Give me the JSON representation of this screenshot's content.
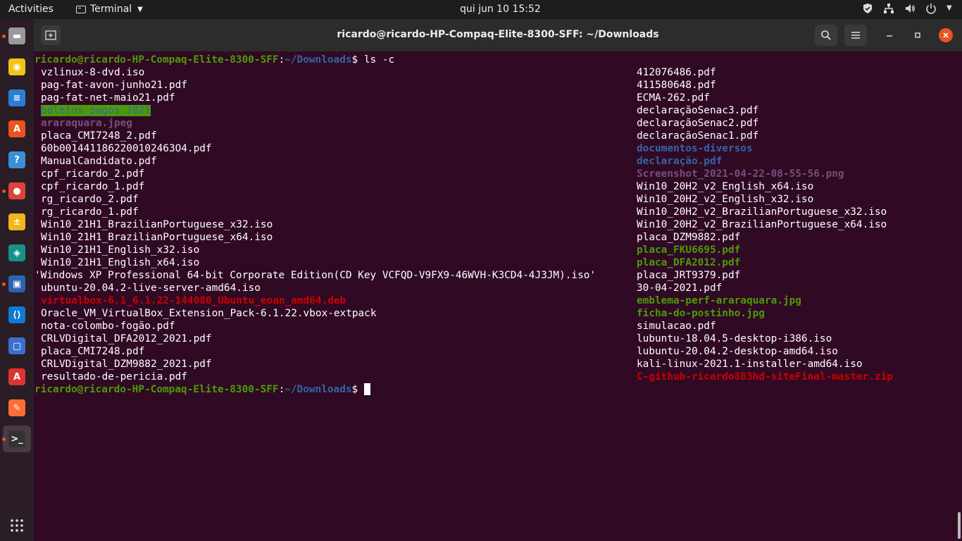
{
  "topbar": {
    "activities": "Activities",
    "app_name": "Terminal",
    "clock": "qui jun 10  15:52"
  },
  "window": {
    "title": "ricardo@ricardo-HP-Compaq-Elite-8300-SFF: ~/Downloads"
  },
  "terminal": {
    "prompt_user": "ricardo@ricardo-HP-Compaq-Elite-8300-SFF",
    "prompt_sep": ":",
    "prompt_path": "~/Downloads",
    "prompt_end": "$ ",
    "command": "ls -c",
    "left_column": [
      {
        "name": "vzlinux-8-dvd.iso",
        "type": "plain"
      },
      {
        "name": "pag-fat-avon-junho21.pdf",
        "type": "plain"
      },
      {
        "name": "pag-fat-net-maio21.pdf",
        "type": "plain"
      },
      {
        "name": "boletos_pagos_2021",
        "type": "otw"
      },
      {
        "name": "araraquara.jpeg",
        "type": "img"
      },
      {
        "name": "placa_CMI7248_2.pdf",
        "type": "plain"
      },
      {
        "name": "60b0014411862200102463O4.pdf",
        "type": "plain"
      },
      {
        "name": "ManualCandidato.pdf",
        "type": "plain"
      },
      {
        "name": "cpf_ricardo_2.pdf",
        "type": "plain"
      },
      {
        "name": "cpf_ricardo_1.pdf",
        "type": "plain"
      },
      {
        "name": "rg_ricardo_2.pdf",
        "type": "plain"
      },
      {
        "name": "rg_ricardo_1.pdf",
        "type": "plain"
      },
      {
        "name": "Win10_21H1_BrazilianPortuguese_x32.iso",
        "type": "plain"
      },
      {
        "name": "Win10_21H1_BrazilianPortuguese_x64.iso",
        "type": "plain"
      },
      {
        "name": "Win10_21H1_English_x32.iso",
        "type": "plain"
      },
      {
        "name": "Win10_21H1_English_x64.iso",
        "type": "plain"
      },
      {
        "name": "'Windows XP Professional 64-bit Corporate Edition(CD Key VCFQD-V9FX9-46WVH-K3CD4-4J3JM).iso'",
        "type": "plain",
        "quoted": true
      },
      {
        "name": "ubuntu-20.04.2-live-server-amd64.iso",
        "type": "plain"
      },
      {
        "name": "virtualbox-6.1_6.1.22-144080_Ubuntu_eoan_amd64.deb",
        "type": "arch"
      },
      {
        "name": "Oracle_VM_VirtualBox_Extension_Pack-6.1.22.vbox-extpack",
        "type": "plain"
      },
      {
        "name": "nota-colombo-fogão.pdf",
        "type": "plain"
      },
      {
        "name": "CRLVDigital_DFA2012_2021.pdf",
        "type": "plain"
      },
      {
        "name": "placa_CMI7248.pdf",
        "type": "plain"
      },
      {
        "name": "CRLVDigital_DZM9882_2021.pdf",
        "type": "plain"
      },
      {
        "name": "resultado-de-pericia.pdf",
        "type": "plain"
      }
    ],
    "right_column": [
      {
        "name": "412076486.pdf",
        "type": "plain"
      },
      {
        "name": "411580648.pdf",
        "type": "plain"
      },
      {
        "name": "ECMA-262.pdf",
        "type": "plain"
      },
      {
        "name": "declaraçãoSenac3.pdf",
        "type": "plain"
      },
      {
        "name": "declaraçãoSenac2.pdf",
        "type": "plain"
      },
      {
        "name": "declaraçãoSenac1.pdf",
        "type": "plain"
      },
      {
        "name": "documentos-diversos",
        "type": "dir"
      },
      {
        "name": "declaração.pdf",
        "type": "dir"
      },
      {
        "name": "Screenshot_2021-04-22-08-55-56.png",
        "type": "img"
      },
      {
        "name": "Win10_20H2_v2_English_x64.iso",
        "type": "plain"
      },
      {
        "name": "Win10_20H2_v2_English_x32.iso",
        "type": "plain"
      },
      {
        "name": "Win10_20H2_v2_BrazilianPortuguese_x32.iso",
        "type": "plain"
      },
      {
        "name": "Win10_20H2_v2_BrazilianPortuguese_x64.iso",
        "type": "plain"
      },
      {
        "name": "placa_DZM9882.pdf",
        "type": "plain"
      },
      {
        "name": "placa_FKU6695.pdf",
        "type": "exec"
      },
      {
        "name": "placa_DFA2012.pdf",
        "type": "exec"
      },
      {
        "name": "placa_JRT9379.pdf",
        "type": "plain"
      },
      {
        "name": "30-04-2021.pdf",
        "type": "plain"
      },
      {
        "name": "emblema-perf-araraquara.jpg",
        "type": "exec"
      },
      {
        "name": "ficha-do-postinho.jpg",
        "type": "exec"
      },
      {
        "name": "simulacao.pdf",
        "type": "plain"
      },
      {
        "name": "lubuntu-18.04.5-desktop-i386.iso",
        "type": "plain"
      },
      {
        "name": "lubuntu-20.04.2-desktop-amd64.iso",
        "type": "plain"
      },
      {
        "name": "kali-linux-2021.1-installer-amd64.iso",
        "type": "plain"
      },
      {
        "name": "C-github-ricardo883hd-siteFinal-master.zip",
        "type": "arch"
      }
    ]
  },
  "dock": [
    {
      "name": "files-icon",
      "color": "#9a9a9a",
      "glyph": "▬"
    },
    {
      "name": "rhythmbox-icon",
      "color": "#f0c419",
      "glyph": "◉"
    },
    {
      "name": "libreoffice-writer-icon",
      "color": "#2a7fd4",
      "glyph": "≡"
    },
    {
      "name": "ubuntu-software-icon",
      "color": "#e95420",
      "glyph": "A"
    },
    {
      "name": "help-icon",
      "color": "#3a8fd8",
      "glyph": "?"
    },
    {
      "name": "chrome-icon",
      "color": "#db4437",
      "glyph": "●"
    },
    {
      "name": "calculator-icon",
      "color": "#f3b519",
      "glyph": "±"
    },
    {
      "name": "gitkraken-icon",
      "color": "#179287",
      "glyph": "◈"
    },
    {
      "name": "virtualbox-icon",
      "color": "#2f61b4",
      "glyph": "▣"
    },
    {
      "name": "vscode-icon",
      "color": "#0e7ad3",
      "glyph": "⟨⟩"
    },
    {
      "name": "screenshot-icon",
      "color": "#3d6ed1",
      "glyph": "▢"
    },
    {
      "name": "document-viewer-icon",
      "color": "#d33",
      "glyph": "A"
    },
    {
      "name": "postman-icon",
      "color": "#ff6c37",
      "glyph": "✎"
    },
    {
      "name": "terminal-icon",
      "color": "#333",
      "glyph": ">_"
    }
  ]
}
